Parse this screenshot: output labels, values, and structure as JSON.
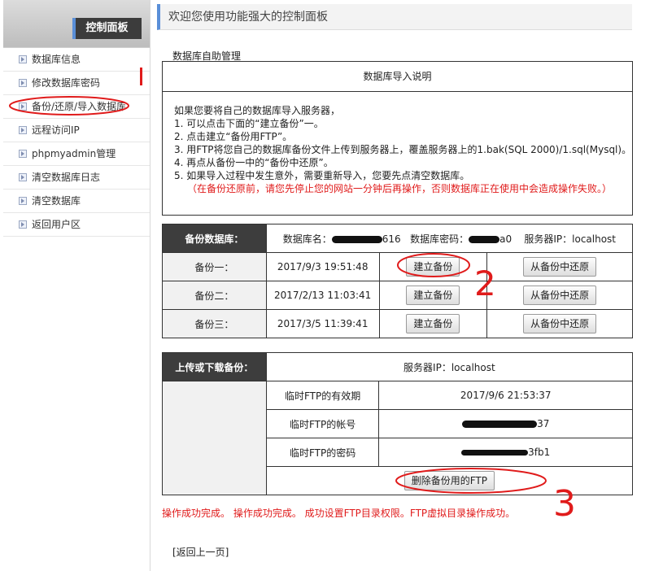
{
  "sidebar": {
    "title": "控制面板",
    "items": [
      {
        "label": "数据库信息"
      },
      {
        "label": "修改数据库密码"
      },
      {
        "label": "备份/还原/导入数据库"
      },
      {
        "label": "远程访问IP"
      },
      {
        "label": "phpmyadmin管理"
      },
      {
        "label": "清空数据库日志"
      },
      {
        "label": "清空数据库"
      },
      {
        "label": "返回用户区"
      }
    ]
  },
  "header": {
    "title": "欢迎您使用功能强大的控制面板"
  },
  "section_label": "数据库自助管理",
  "instructions": {
    "title": "数据库导入说明",
    "lines": [
      "如果您要将自己的数据库导入服务器，",
      "1. 可以点击下面的“建立备份”一。",
      "2. 点击建立“备份用FTP”。",
      "3. 用FTP将您自己的数据库备份文件上传到服务器上，覆盖服务器上的1.bak(SQL 2000)/1.sql(Mysql)。",
      "4. 再点从备份一中的“备份中还原”。",
      "5. 如果导入过程中发生意外，需要重新导入，您要先点清空数据库。"
    ],
    "warning": "（在备份还原前，请您先停止您的网站一分钟后再操作，否则数据库正在使用中会造成操作失败。）"
  },
  "backup": {
    "header_label": "备份数据库：",
    "db_name_label": "数据库名：",
    "db_name_suffix": "616",
    "db_pass_label": "数据库密码：",
    "db_pass_suffix": "a0",
    "server_ip_label": "服务器IP：localhost",
    "rows": [
      {
        "label": "备份一：",
        "date": "2017/9/3 19:51:48",
        "create": "建立备份",
        "restore": "从备份中还原"
      },
      {
        "label": "备份二：",
        "date": "2017/2/13 11:03:41",
        "create": "建立备份",
        "restore": "从备份中还原"
      },
      {
        "label": "备份三：",
        "date": "2017/3/5 11:39:41",
        "create": "建立备份",
        "restore": "从备份中还原"
      }
    ]
  },
  "ftp": {
    "header_label": "上传或下载备份：",
    "server_ip": "服务器IP：localhost",
    "valid_label": "临时FTP的有效期",
    "valid_value": "2017/9/6 21:53:37",
    "account_label": "临时FTP的帐号",
    "account_suffix": "37",
    "password_label": "临时FTP的密码",
    "password_suffix": "3fb1",
    "delete_button": "删除备份用的FTP"
  },
  "status": "操作成功完成。 操作成功完成。 成功设置FTP目录权限。FTP虚拟目录操作成功。",
  "back_link": "[返回上一页]",
  "annotations": {
    "mark_2": "2",
    "mark_3": "3",
    "color": "#e01b1b"
  }
}
